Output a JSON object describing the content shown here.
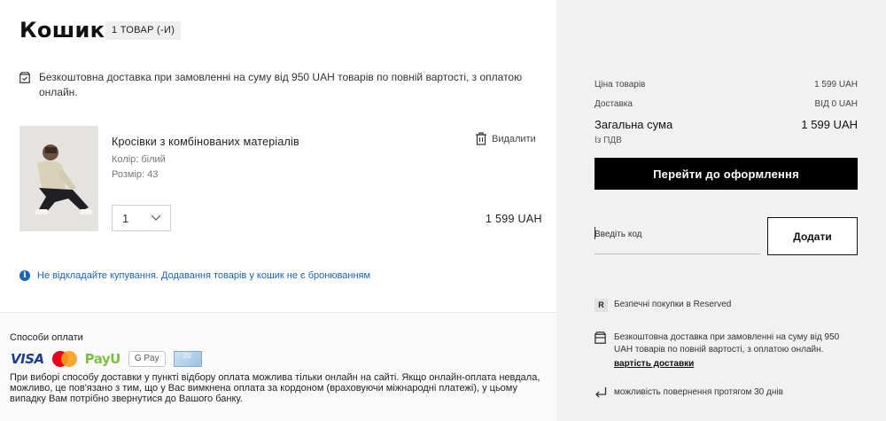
{
  "cart": {
    "title": "Кошик",
    "count": "1 ТОВАР (-И)",
    "free_delivery": "Безкоштовна доставка при замовленні на суму від 950 UAH товарів по повній вартості, з оплатою онлайн."
  },
  "product": {
    "name": "Кросівки з комбінованих матеріалів",
    "color": "Колір: білий",
    "size": "Розмір: 43",
    "delete_label": "Видалити",
    "quantity": "1",
    "price": "1 599 UAH"
  },
  "notice": "Не відкладайте купування. Додавання товарів у кошик не є бронюванням",
  "payment": {
    "title": "Способи оплати",
    "logos": [
      "VISA",
      "mastercard",
      "PayU",
      "G Pay",
      "20"
    ],
    "note": "При виборі способу доставки у пункті відбору оплата можлива тільки онлайн на сайті. Якщо онлайн-оплата невдала, можливо, це пов'язано з тим, що у Вас вимкнена оплата за кордоном (враховуючи міжнародні платежі), у цьому випадку Вам потрібно звернутися до Вашого банку."
  },
  "summary": {
    "items_label": "Ціна товарів",
    "items_value": "1 599 UAH",
    "delivery_label": "Доставка",
    "delivery_value": "ВІД 0 UAH",
    "total_label": "Загальна сума",
    "total_value": "1 599 UAH",
    "vat": "Із ПДВ",
    "checkout_button": "Перейти до оформлення",
    "promo_placeholder": "Введіть код",
    "add_button": "Додати"
  },
  "info": {
    "secure_badge": "R",
    "secure": "Безпечні покупки в Reserved",
    "delivery": "Безкоштовна доставка при замовленні на суму від 950 UAH товарів по повній вартості, з оплатою онлайн.",
    "delivery_link": "вартість доставки",
    "returns": "можливість повернення протягом 30 днів"
  },
  "colors": {
    "accent_blue": "#1b63b5",
    "sidebar_bg": "#f1f1f1",
    "checkout_bg": "#000000"
  }
}
